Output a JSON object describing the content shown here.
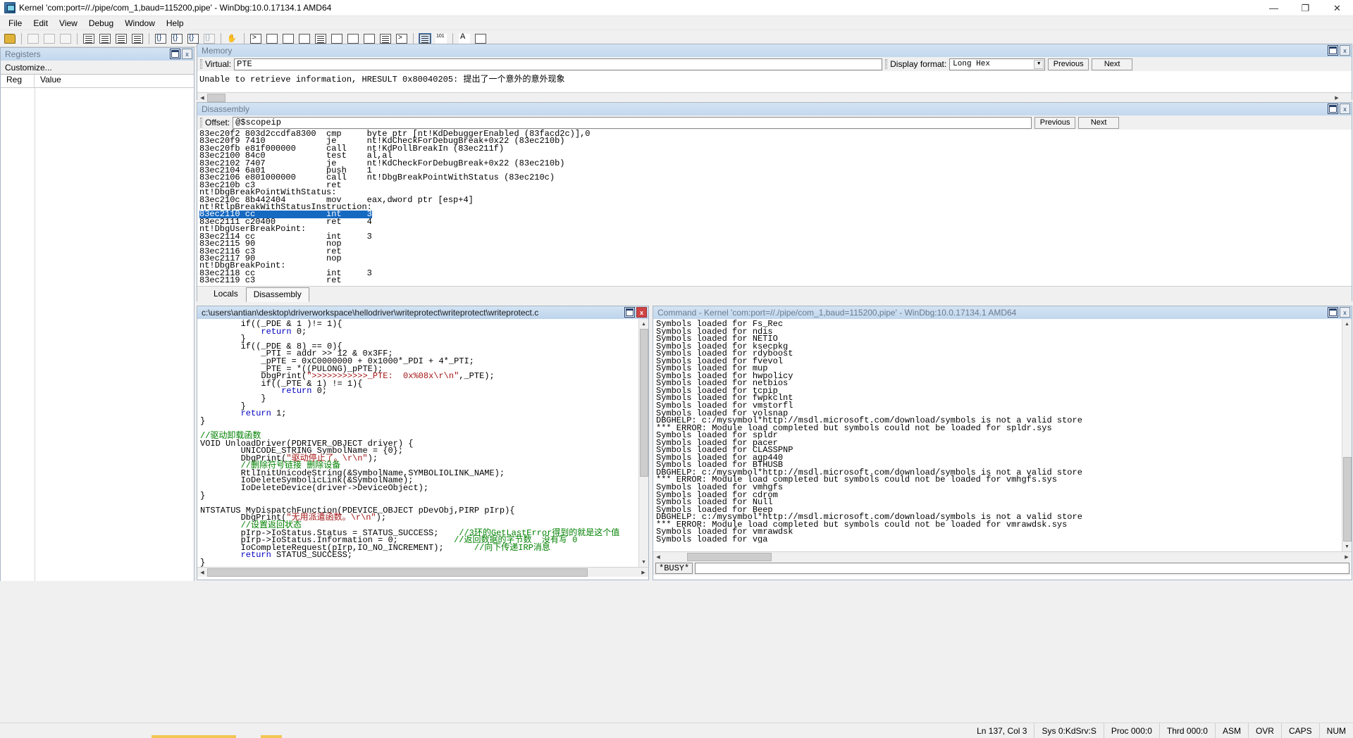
{
  "window": {
    "title": "Kernel 'com:port=//./pipe/com_1,baud=115200,pipe' - WinDbg:10.0.17134.1 AMD64",
    "minimize": "—",
    "maximize": "❐",
    "close": "✕"
  },
  "menu": [
    "File",
    "Edit",
    "View",
    "Debug",
    "Window",
    "Help"
  ],
  "toolbar": {
    "icons": [
      "open-file-icon",
      "cut-icon",
      "copy-icon",
      "paste-icon",
      "step-into-icon",
      "step-over-icon",
      "stop-debug-icon",
      "break-icon",
      "run-icon",
      "step-out-icon",
      "restart-icon",
      "trace-icon",
      "hand-icon",
      "command-window-icon",
      "watch-window-icon",
      "locals-window-icon",
      "registers-window-icon",
      "memory-window-icon",
      "callstack-window-icon",
      "disassembly-window-icon",
      "blank-window-icon",
      "scratchpad-icon",
      "shell-icon",
      "source-mode-icon",
      "numbers-icon",
      "font-icon",
      "options-icon"
    ]
  },
  "registers": {
    "caption": "Registers",
    "customize": "Customize...",
    "columns": [
      "Reg",
      "Value"
    ],
    "rows": []
  },
  "memory": {
    "caption": "Memory",
    "virtual_label": "Virtual:",
    "virtual_value": "PTE",
    "display_format_label": "Display format:",
    "display_format_value": "Long Hex",
    "previous_label": "Previous",
    "next_label": "Next",
    "content": "Unable to retrieve information, HRESULT 0x80040205: 提出了一个意外的意外现象"
  },
  "disassembly": {
    "caption": "Disassembly",
    "offset_label": "Offset:",
    "offset_value": "@$scopeip",
    "previous_label": "Previous",
    "next_label": "Next",
    "lines": [
      "83ec20f2 803d2ccdfa8300  cmp     byte ptr [nt!KdDebuggerEnabled (83facd2c)],0",
      "83ec20f9 7410            je      nt!KdCheckForDebugBreak+0x22 (83ec210b)",
      "83ec20fb e81f000000      call    nt!KdPollBreakIn (83ec211f)",
      "83ec2100 84c0            test    al,al",
      "83ec2102 7407            je      nt!KdCheckForDebugBreak+0x22 (83ec210b)",
      "83ec2104 6a01            push    1",
      "83ec2106 e801000000      call    nt!DbgBreakPointWithStatus (83ec210c)",
      "83ec210b c3              ret",
      "nt!DbgBreakPointWithStatus:",
      "83ec210c 8b442404        mov     eax,dword ptr [esp+4]",
      "nt!RtlpBreakWithStatusInstruction:",
      "83ec2111 c20400          ret     4",
      "nt!DbgUserBreakPoint:",
      "83ec2114 cc              int     3",
      "83ec2115 90              nop",
      "83ec2116 c3              ret",
      "83ec2117 90              nop",
      "nt!DbgBreakPoint:",
      "83ec2118 cc              int     3",
      "83ec2119 c3              ret"
    ],
    "highlight_line": "83ec2110 cc              int     3",
    "tabs": [
      {
        "label": "Locals",
        "active": false
      },
      {
        "label": "Disassembly",
        "active": true
      }
    ]
  },
  "source": {
    "path": "c:\\users\\antian\\desktop\\driverworkspace\\hellodriver\\writeprotect\\writeprotect\\writeprotect.c",
    "code_lines": [
      {
        "indent": 8,
        "parts": [
          {
            "t": "if((_PDE & 1 )!= 1){",
            "c": ""
          }
        ]
      },
      {
        "indent": 12,
        "parts": [
          {
            "t": "return",
            "c": "kw"
          },
          {
            "t": " 0;",
            "c": ""
          }
        ]
      },
      {
        "indent": 8,
        "parts": [
          {
            "t": "}",
            "c": ""
          }
        ]
      },
      {
        "indent": 8,
        "parts": [
          {
            "t": "if((_PDE & 8) == 0){",
            "c": ""
          }
        ]
      },
      {
        "indent": 12,
        "parts": [
          {
            "t": "_PTI = addr >> 12 & 0x3FF;",
            "c": ""
          }
        ]
      },
      {
        "indent": 12,
        "parts": [
          {
            "t": "_pPTE = 0xC0000000 + 0x1000*_PDI + 4*_PTI;",
            "c": ""
          }
        ]
      },
      {
        "indent": 12,
        "parts": [
          {
            "t": "_PTE = *((PULONG)_pPTE);",
            "c": ""
          }
        ]
      },
      {
        "indent": 12,
        "parts": [
          {
            "t": "DbgPrint(",
            "c": ""
          },
          {
            "t": "\">>>>>>>>>>>_PTE:  0x%08x\\r\\n\"",
            "c": "str"
          },
          {
            "t": ",_PTE);",
            "c": ""
          }
        ]
      },
      {
        "indent": 12,
        "parts": [
          {
            "t": "if((_PTE & 1) != 1){",
            "c": ""
          }
        ]
      },
      {
        "indent": 16,
        "parts": [
          {
            "t": "return",
            "c": "kw"
          },
          {
            "t": " 0;",
            "c": ""
          }
        ]
      },
      {
        "indent": 12,
        "parts": [
          {
            "t": "}",
            "c": ""
          }
        ]
      },
      {
        "indent": 8,
        "parts": [
          {
            "t": "}",
            "c": ""
          }
        ]
      },
      {
        "indent": 8,
        "parts": [
          {
            "t": "return",
            "c": "kw"
          },
          {
            "t": " 1;",
            "c": ""
          }
        ]
      },
      {
        "indent": 0,
        "parts": [
          {
            "t": "}",
            "c": ""
          }
        ]
      },
      {
        "indent": 0,
        "parts": [
          {
            "t": "",
            "c": ""
          }
        ]
      },
      {
        "indent": 0,
        "parts": [
          {
            "t": "//驱动卸载函数",
            "c": "cmt"
          }
        ]
      },
      {
        "indent": 0,
        "parts": [
          {
            "t": "VOID UnloadDriver(PDRIVER_OBJECT driver) {",
            "c": ""
          }
        ]
      },
      {
        "indent": 8,
        "parts": [
          {
            "t": "UNICODE_STRING SymbolName = {0};",
            "c": ""
          }
        ]
      },
      {
        "indent": 8,
        "parts": [
          {
            "t": "DbgPrint(",
            "c": ""
          },
          {
            "t": "\"驱动停止了。\\r\\n\"",
            "c": "str"
          },
          {
            "t": ");",
            "c": ""
          }
        ]
      },
      {
        "indent": 8,
        "parts": [
          {
            "t": "//删除符号链接 删除设备",
            "c": "cmt"
          }
        ]
      },
      {
        "indent": 8,
        "parts": [
          {
            "t": "RtlInitUnicodeString(&SymbolName,SYMBOLIOLINK_NAME);",
            "c": ""
          }
        ]
      },
      {
        "indent": 8,
        "parts": [
          {
            "t": "IoDeleteSymbolicLink(&SymbolName);",
            "c": ""
          }
        ]
      },
      {
        "indent": 8,
        "parts": [
          {
            "t": "IoDeleteDevice(driver->DeviceObject);",
            "c": ""
          }
        ]
      },
      {
        "indent": 0,
        "parts": [
          {
            "t": "}",
            "c": ""
          }
        ]
      },
      {
        "indent": 0,
        "parts": [
          {
            "t": "",
            "c": ""
          }
        ]
      },
      {
        "indent": 0,
        "parts": [
          {
            "t": "NTSTATUS MyDispatchFunction(PDEVICE_OBJECT pDevObj,PIRP pIrp){",
            "c": ""
          }
        ]
      },
      {
        "indent": 8,
        "parts": [
          {
            "t": "DbgPrint(",
            "c": ""
          },
          {
            "t": "\"无用派遣函数。\\r\\n\"",
            "c": "str"
          },
          {
            "t": ");",
            "c": ""
          }
        ]
      },
      {
        "indent": 8,
        "parts": [
          {
            "t": "//设置返回状态",
            "c": "cmt"
          }
        ]
      },
      {
        "indent": 8,
        "parts": [
          {
            "t": "pIrp->IoStatus.Status = STATUS_SUCCESS;    ",
            "c": ""
          },
          {
            "t": "//3环的GetLastError得到的就是这个值",
            "c": "cmt"
          }
        ]
      },
      {
        "indent": 8,
        "parts": [
          {
            "t": "pIrp->IoStatus.Information = 0;           ",
            "c": ""
          },
          {
            "t": "//返回数据的字节数  没有写 0",
            "c": "cmt"
          }
        ]
      },
      {
        "indent": 8,
        "parts": [
          {
            "t": "IoCompleteRequest(pIrp,IO_NO_INCREMENT);      ",
            "c": ""
          },
          {
            "t": "//向下传递IRP消息",
            "c": "cmt"
          }
        ]
      },
      {
        "indent": 8,
        "parts": [
          {
            "t": "return",
            "c": "kw"
          },
          {
            "t": " STATUS_SUCCESS;",
            "c": ""
          }
        ]
      },
      {
        "indent": 0,
        "parts": [
          {
            "t": "}",
            "c": ""
          }
        ]
      }
    ]
  },
  "command": {
    "caption": "Command - Kernel 'com:port=//./pipe/com_1,baud=115200,pipe' - WinDbg:10.0.17134.1 AMD64",
    "lines": [
      "Symbols loaded for Fs_Rec",
      "Symbols loaded for ndis",
      "Symbols loaded for NETIO",
      "Symbols loaded for ksecpkg",
      "Symbols loaded for rdyboost",
      "Symbols loaded for fvevol",
      "Symbols loaded for mup",
      "Symbols loaded for hwpolicy",
      "Symbols loaded for netbios",
      "Symbols loaded for tcpip",
      "Symbols loaded for fwpkclnt",
      "Symbols loaded for vmstorfl",
      "Symbols loaded for volsnap",
      "DBGHELP: c:/mysymbol*http://msdl.microsoft.com/download/symbols is not a valid store",
      "*** ERROR: Module load completed but symbols could not be loaded for spldr.sys",
      "Symbols loaded for spldr",
      "Symbols loaded for pacer",
      "Symbols loaded for CLASSPNP",
      "Symbols loaded for agp440",
      "Symbols loaded for BTHUSB",
      "DBGHELP: c:/mysymbol*http://msdl.microsoft.com/download/symbols is not a valid store",
      "*** ERROR: Module load completed but symbols could not be loaded for vmhgfs.sys",
      "Symbols loaded for vmhgfs",
      "Symbols loaded for cdrom",
      "Symbols loaded for Null",
      "Symbols loaded for Beep",
      "DBGHELP: c:/mysymbol*http://msdl.microsoft.com/download/symbols is not a valid store",
      "*** ERROR: Module load completed but symbols could not be loaded for vmrawdsk.sys",
      "Symbols loaded for vmrawdsk",
      "Symbols loaded for vga"
    ],
    "prompt": "*BUSY*",
    "input_value": ""
  },
  "statusbar": {
    "cursor": "Ln 137, Col 3",
    "sys": "Sys 0:KdSrv:S",
    "proc": "Proc 000:0",
    "thrd": "Thrd 000:0",
    "asm": "ASM",
    "ovr": "OVR",
    "caps": "CAPS",
    "num": "NUM"
  }
}
